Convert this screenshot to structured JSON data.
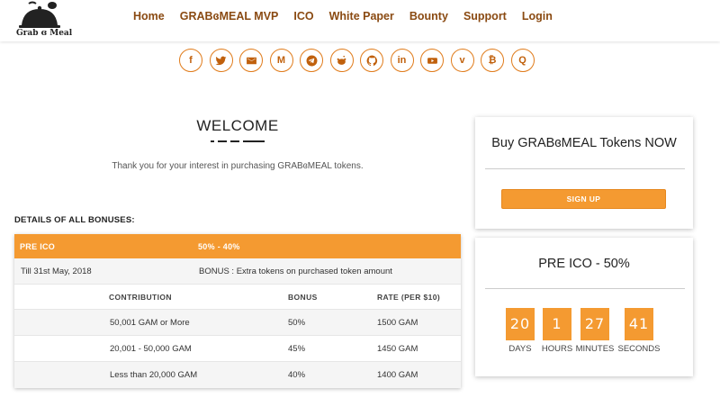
{
  "brand": {
    "name": "Grab ɞ Meal"
  },
  "nav": [
    "Home",
    "GRABɞMEAL MVP",
    "ICO",
    "White Paper",
    "Bounty",
    "Support",
    "Login"
  ],
  "social": [
    {
      "icon": "facebook-icon",
      "glyph": "f"
    },
    {
      "icon": "twitter-icon",
      "glyph": ""
    },
    {
      "icon": "email-icon",
      "glyph": ""
    },
    {
      "icon": "medium-icon",
      "glyph": "M"
    },
    {
      "icon": "telegram-icon",
      "glyph": ""
    },
    {
      "icon": "reddit-icon",
      "glyph": ""
    },
    {
      "icon": "github-icon",
      "glyph": ""
    },
    {
      "icon": "linkedin-icon",
      "glyph": "in"
    },
    {
      "icon": "youtube-icon",
      "glyph": ""
    },
    {
      "icon": "vimeo-icon",
      "glyph": "v"
    },
    {
      "icon": "bitcoin-icon",
      "glyph": "₿"
    },
    {
      "icon": "quora-icon",
      "glyph": "Q"
    }
  ],
  "welcome": {
    "title": "WELCOME",
    "text": "Thank you for your interest in purchasing GRABɞMEAL tokens."
  },
  "bonuses": {
    "title": "DETAILS OF ALL BONUSES:",
    "header": {
      "name": "PRE ICO",
      "range": "50% - 40%"
    },
    "period": {
      "date": "Till 31st May, 2018",
      "bonus": "BONUS : Extra tokens on purchased token amount"
    },
    "columns": [
      "CONTRIBUTION",
      "BONUS",
      "RATE (PER $10)"
    ],
    "rows": [
      [
        "50,001 GAM or More",
        "50%",
        "1500 GAM"
      ],
      [
        "20,001 - 50,000 GAM",
        "45%",
        "1450 GAM"
      ],
      [
        "Less than 20,000 GAM",
        "40%",
        "1400 GAM"
      ]
    ]
  },
  "buy_card": {
    "title": "Buy GRABɞMEAL Tokens NOW",
    "button": "SIGN UP"
  },
  "pre_card": {
    "title": "PRE ICO - 50%",
    "countdown": [
      {
        "value": "20",
        "label": "DAYS"
      },
      {
        "value": "1",
        "label": "HOURS"
      },
      {
        "value": "27",
        "label": "MINUTES"
      },
      {
        "value": "41",
        "label": "SECONDS"
      }
    ]
  },
  "colors": {
    "accent": "#f49a31",
    "nav": "#8a4a12",
    "icon": "#c0600c"
  }
}
